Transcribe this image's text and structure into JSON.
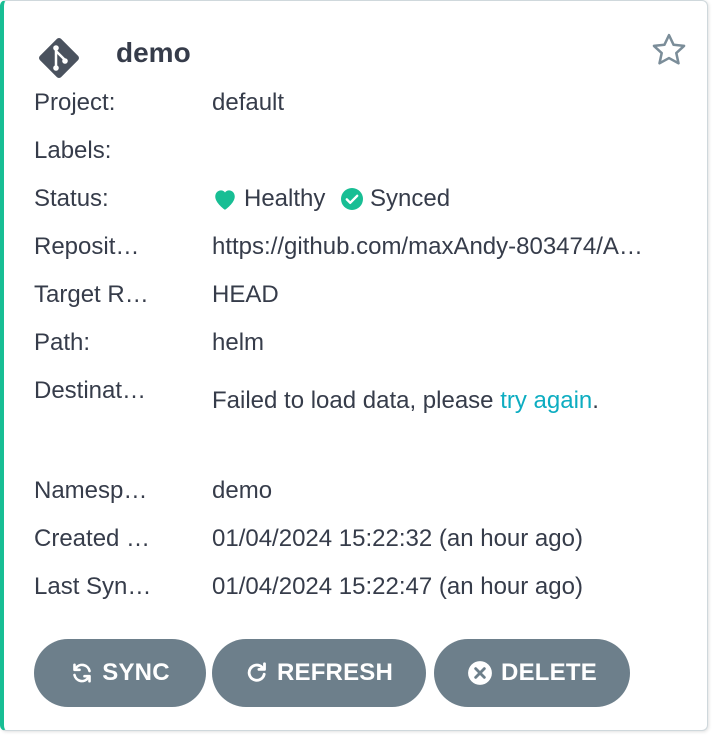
{
  "app": {
    "name": "demo",
    "icon": "git-branch-icon",
    "favorite_icon": "star-outline-icon"
  },
  "fields": {
    "project_label": "Project:",
    "project_value": "default",
    "labels_label": "Labels:",
    "labels_value": "",
    "status_label": "Status:",
    "health_text": "Healthy",
    "sync_text": "Synced",
    "repository_label": "Reposit…",
    "repository_value": "https://github.com/maxAndy-803474/A…",
    "target_label": "Target R…",
    "target_value": "HEAD",
    "path_label": "Path:",
    "path_value": "helm",
    "destination_label": "Destinat…",
    "destination_error_prefix": "Failed to load data, please ",
    "destination_error_link": "try again",
    "destination_error_suffix": ".",
    "namespace_label": "Namesp…",
    "namespace_value": "demo",
    "created_label": "Created …",
    "created_value": "01/04/2024 15:22:32  (an hour ago)",
    "lastsync_label": "Last Syn…",
    "lastsync_value": "01/04/2024 15:22:47  (an hour ago)"
  },
  "actions": {
    "sync_label": "SYNC",
    "refresh_label": "REFRESH",
    "delete_label": "DELETE"
  },
  "colors": {
    "accent_border": "#18be94",
    "healthy": "#18be94",
    "synced": "#18be94",
    "link": "#0dadc1",
    "button_bg": "#6d7f8b",
    "text": "#363c4a"
  }
}
